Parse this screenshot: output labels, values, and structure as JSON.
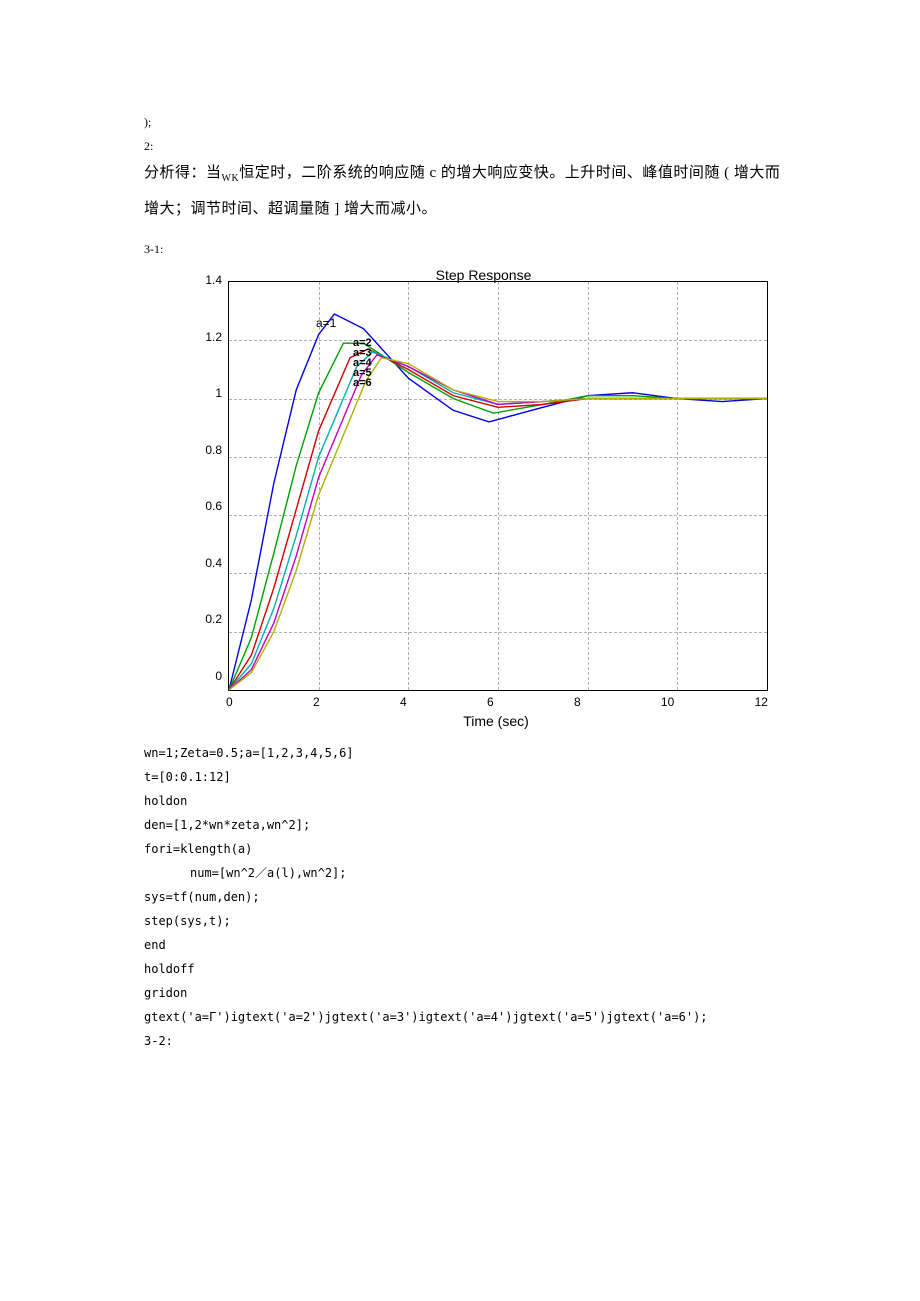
{
  "pre_lines": {
    "l1": ");",
    "l2": "2:"
  },
  "prose": {
    "line1_a": "分析得：当",
    "wk": "WK",
    "line1_b": "恒定时，二阶系统的响应随 c 的增大响应变快。上升时间、峰值时间随 ( 增大而",
    "line2": "增大；调节时间、超调量随 ] 增大而减小。"
  },
  "section_label_31": "3-1:",
  "chart_data": {
    "type": "line",
    "title": "Step Response",
    "xlabel": "Time (sec)",
    "ylabel": "",
    "xlim": [
      0,
      12
    ],
    "ylim": [
      0,
      1.4
    ],
    "xticks": [
      0,
      2,
      4,
      6,
      8,
      10,
      12
    ],
    "yticks": [
      0,
      0.2,
      0.4,
      0.6,
      0.8,
      1.0,
      1.2,
      1.4
    ],
    "series": [
      {
        "name": "a=1",
        "color": "#0000e0",
        "data": [
          [
            0,
            0
          ],
          [
            0.5,
            0.31
          ],
          [
            1,
            0.71
          ],
          [
            1.5,
            1.03
          ],
          [
            2,
            1.22
          ],
          [
            2.35,
            1.29
          ],
          [
            3,
            1.24
          ],
          [
            4,
            1.07
          ],
          [
            5,
            0.96
          ],
          [
            5.8,
            0.92
          ],
          [
            7,
            0.97
          ],
          [
            8,
            1.01
          ],
          [
            9,
            1.02
          ],
          [
            10,
            1.0
          ],
          [
            11,
            0.99
          ],
          [
            12,
            1.0
          ]
        ]
      },
      {
        "name": "a=2",
        "color": "#00a000",
        "data": [
          [
            0,
            0
          ],
          [
            0.5,
            0.18
          ],
          [
            1,
            0.47
          ],
          [
            1.5,
            0.77
          ],
          [
            2,
            1.02
          ],
          [
            2.55,
            1.19
          ],
          [
            3,
            1.19
          ],
          [
            4,
            1.09
          ],
          [
            5,
            1.0
          ],
          [
            5.9,
            0.95
          ],
          [
            7,
            0.98
          ],
          [
            8,
            1.01
          ],
          [
            9,
            1.01
          ],
          [
            10,
            1.0
          ],
          [
            11,
            1.0
          ],
          [
            12,
            1.0
          ]
        ]
      },
      {
        "name": "a=3",
        "color": "#d00000",
        "data": [
          [
            0,
            0
          ],
          [
            0.5,
            0.12
          ],
          [
            1,
            0.35
          ],
          [
            1.5,
            0.62
          ],
          [
            2,
            0.89
          ],
          [
            2.7,
            1.14
          ],
          [
            3.1,
            1.17
          ],
          [
            4,
            1.1
          ],
          [
            5,
            1.01
          ],
          [
            6,
            0.97
          ],
          [
            7,
            0.98
          ],
          [
            8,
            1.0
          ],
          [
            9,
            1.0
          ],
          [
            10,
            1.0
          ],
          [
            11,
            1.0
          ],
          [
            12,
            1.0
          ]
        ]
      },
      {
        "name": "a=4",
        "color": "#00b0b0",
        "data": [
          [
            0,
            0
          ],
          [
            0.5,
            0.09
          ],
          [
            1,
            0.28
          ],
          [
            1.5,
            0.53
          ],
          [
            2,
            0.8
          ],
          [
            2.85,
            1.11
          ],
          [
            3.2,
            1.16
          ],
          [
            4,
            1.11
          ],
          [
            5,
            1.02
          ],
          [
            6,
            0.98
          ],
          [
            7,
            0.99
          ],
          [
            8,
            1.0
          ],
          [
            9,
            1.0
          ],
          [
            10,
            1.0
          ],
          [
            11,
            1.0
          ],
          [
            12,
            1.0
          ]
        ]
      },
      {
        "name": "a=5",
        "color": "#c000c0",
        "data": [
          [
            0,
            0
          ],
          [
            0.5,
            0.07
          ],
          [
            1,
            0.23
          ],
          [
            1.5,
            0.46
          ],
          [
            2,
            0.73
          ],
          [
            2.95,
            1.08
          ],
          [
            3.3,
            1.15
          ],
          [
            4,
            1.11
          ],
          [
            5,
            1.03
          ],
          [
            6,
            0.98
          ],
          [
            7,
            0.99
          ],
          [
            8,
            1.0
          ],
          [
            9,
            1.0
          ],
          [
            10,
            1.0
          ],
          [
            11,
            1.0
          ],
          [
            12,
            1.0
          ]
        ]
      },
      {
        "name": "a=6",
        "color": "#b0b000",
        "data": [
          [
            0,
            0
          ],
          [
            0.5,
            0.06
          ],
          [
            1,
            0.2
          ],
          [
            1.5,
            0.41
          ],
          [
            2,
            0.67
          ],
          [
            3.05,
            1.06
          ],
          [
            3.4,
            1.14
          ],
          [
            4,
            1.12
          ],
          [
            5,
            1.03
          ],
          [
            6,
            0.99
          ],
          [
            7,
            0.99
          ],
          [
            8,
            1.0
          ],
          [
            9,
            1.0
          ],
          [
            10,
            1.0
          ],
          [
            11,
            1.0
          ],
          [
            12,
            1.0
          ]
        ]
      }
    ],
    "annotations": {
      "a1": "a=1",
      "clump": "a=2\na=3\na=4\na=5\na=6"
    }
  },
  "code": {
    "l1": "wn=1;Zeta=0.5;a=[1,2,3,4,5,6]",
    "l2": "t=[0:0.1:12]",
    "l3": "holdon",
    "l4": "den=[1,2*wn*zeta,wn^2];",
    "l5": "fori=klength(a)",
    "l6": "num=[wn^2／a(l),wn^2];",
    "l7": "sys=tf(num,den);",
    "l8": "step(sys,t);",
    "l9": "end",
    "l10": "holdoff",
    "l11": "gridon",
    "l12": "gtext('a=Γ')igtext('a=2')jgtext('a=3')igtext('a=4')jgtext('a=5')jgtext('a=6');",
    "l13": "3-2:"
  }
}
